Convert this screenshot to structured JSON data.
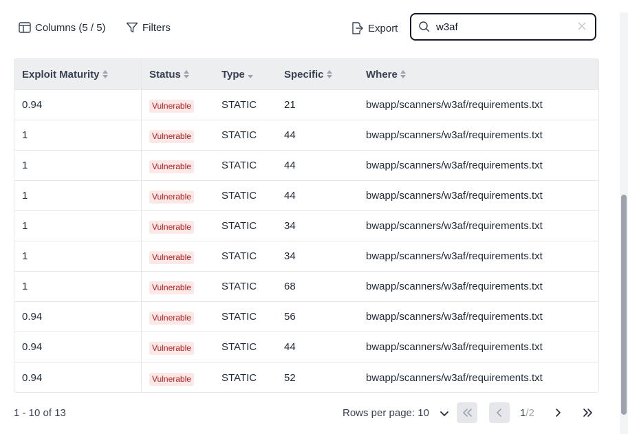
{
  "toolbar": {
    "columns_label": "Columns (5 / 5)",
    "filters_label": "Filters",
    "export_label": "Export"
  },
  "search": {
    "value": "w3af"
  },
  "table": {
    "headers": [
      "Exploit Maturity",
      "Status",
      "Type",
      "Specific",
      "Where"
    ],
    "rows": [
      [
        "0.94",
        "Vulnerable",
        "STATIC",
        "21",
        "bwapp/scanners/w3af/requirements.txt"
      ],
      [
        "1",
        "Vulnerable",
        "STATIC",
        "44",
        "bwapp/scanners/w3af/requirements.txt"
      ],
      [
        "1",
        "Vulnerable",
        "STATIC",
        "44",
        "bwapp/scanners/w3af/requirements.txt"
      ],
      [
        "1",
        "Vulnerable",
        "STATIC",
        "44",
        "bwapp/scanners/w3af/requirements.txt"
      ],
      [
        "1",
        "Vulnerable",
        "STATIC",
        "34",
        "bwapp/scanners/w3af/requirements.txt"
      ],
      [
        "1",
        "Vulnerable",
        "STATIC",
        "34",
        "bwapp/scanners/w3af/requirements.txt"
      ],
      [
        "1",
        "Vulnerable",
        "STATIC",
        "68",
        "bwapp/scanners/w3af/requirements.txt"
      ],
      [
        "0.94",
        "Vulnerable",
        "STATIC",
        "56",
        "bwapp/scanners/w3af/requirements.txt"
      ],
      [
        "0.94",
        "Vulnerable",
        "STATIC",
        "44",
        "bwapp/scanners/w3af/requirements.txt"
      ],
      [
        "0.94",
        "Vulnerable",
        "STATIC",
        "52",
        "bwapp/scanners/w3af/requirements.txt"
      ]
    ]
  },
  "footer": {
    "range": "1 - 10 of 13",
    "rows_per_page_label": "Rows per page: 10",
    "page_current": "1",
    "page_total": "/2"
  },
  "colors": {
    "badge_bg": "#fde8e8",
    "badge_text": "#b91c1c",
    "header_bg": "#edeef0",
    "border": "#e5e7eb"
  },
  "icons": {
    "columns": "columns-icon",
    "filters": "filter-icon",
    "export": "export-icon",
    "search": "search-icon",
    "clear": "close-icon",
    "sort": "sort-icon",
    "first": "chevrons-left-icon",
    "prev": "chevron-left-icon",
    "next": "chevron-right-icon",
    "last": "chevrons-right-icon",
    "dropdown": "chevron-down-icon"
  }
}
